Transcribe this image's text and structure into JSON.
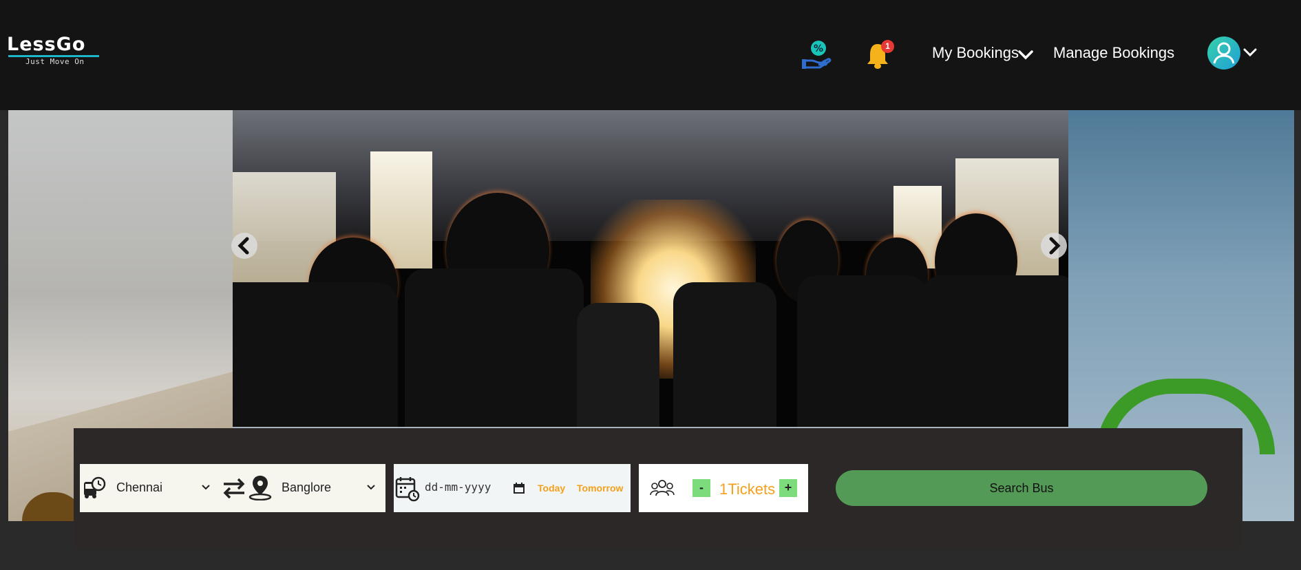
{
  "brand": {
    "name": "LessGo",
    "tagline": "Just Move On"
  },
  "header": {
    "offers_icon": "offer-percent-hand-icon",
    "notifications": {
      "icon": "bell-icon",
      "count": "1"
    },
    "nav": {
      "my_bookings": "My Bookings",
      "manage_bookings": "Manage Bookings"
    },
    "account_icon": "user-avatar-icon"
  },
  "carousel": {
    "prev_icon": "chevron-left-icon",
    "next_icon": "chevron-right-icon"
  },
  "search": {
    "from_city": "Chennai",
    "to_city": "Banglore",
    "date_placeholder": "dd-mm-yyyy",
    "today_label": "Today",
    "tomorrow_label": "Tomorrow",
    "minus_label": "-",
    "plus_label": "+",
    "tickets_label": "1Tickets",
    "search_button": "Search Bus"
  },
  "colors": {
    "header_bg": "#141414",
    "panel_bg": "#2b2827",
    "accent_orange": "#f4a01c",
    "search_green": "#539a56",
    "qty_green": "#7cdc7c",
    "avatar_teal": "#19c4b8",
    "bell_yellow": "#f6b21a",
    "badge_red": "#e53935"
  }
}
